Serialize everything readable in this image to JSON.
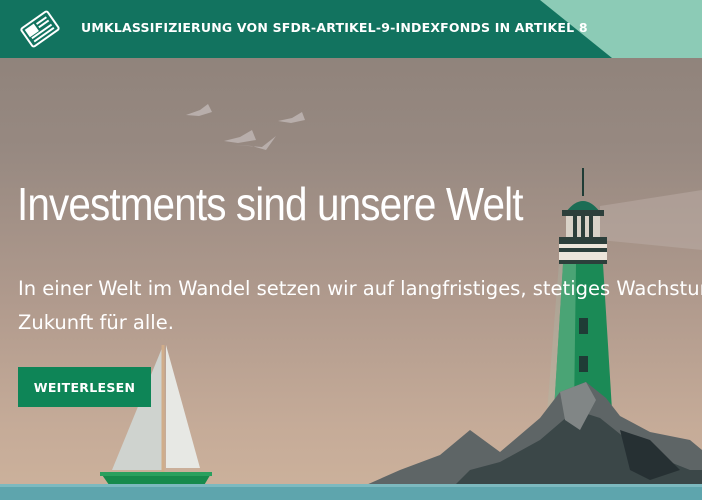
{
  "banner": {
    "text": "UMKLASSIFIZIERUNG VON SFDR-ARTIKEL-9-INDEXFONDS IN ARTIKEL 8",
    "icon": "newspaper-icon",
    "color_dark": "#12735f",
    "color_light": "#8ccbb6"
  },
  "hero": {
    "headline": "Investments sind unsere Welt",
    "subline_1": "In einer Welt im Wandel setzen wir auf langfristiges, stetiges Wachstum",
    "subline_2": "Zukunft für alle.",
    "cta_label": "WEITERLESEN",
    "cta_color": "#0e8557"
  },
  "illustration": {
    "elements": [
      "lighthouse",
      "sailboat",
      "rocks",
      "birds",
      "sea"
    ]
  }
}
